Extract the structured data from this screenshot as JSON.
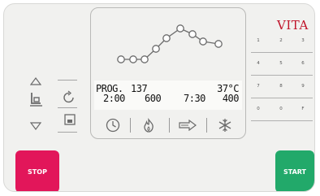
{
  "brand": "VITA",
  "lcd": {
    "program_label": "PROG.",
    "program_number": "137",
    "temperature": "37°C",
    "time_1": "2:00",
    "value_1": "600",
    "time_2": "7:30",
    "value_2": "400"
  },
  "keypad": {
    "keys": [
      "1",
      "2",
      "3",
      "4",
      "5",
      "6",
      "7",
      "8",
      "9",
      "0",
      "0",
      "F"
    ]
  },
  "buttons": {
    "stop": "STOP",
    "start": "START"
  },
  "icons": {
    "lcd_row": [
      "clock-icon",
      "flame-icon",
      "arrow-right-icon",
      "snowflake-icon"
    ],
    "left": [
      "arrow-up-icon",
      "chair-icon",
      "arrow-down-icon",
      "rotate-icon",
      "save-icon"
    ]
  },
  "colors": {
    "stop": "#e2165a",
    "start": "#22a96a",
    "brand": "#c0142a"
  }
}
